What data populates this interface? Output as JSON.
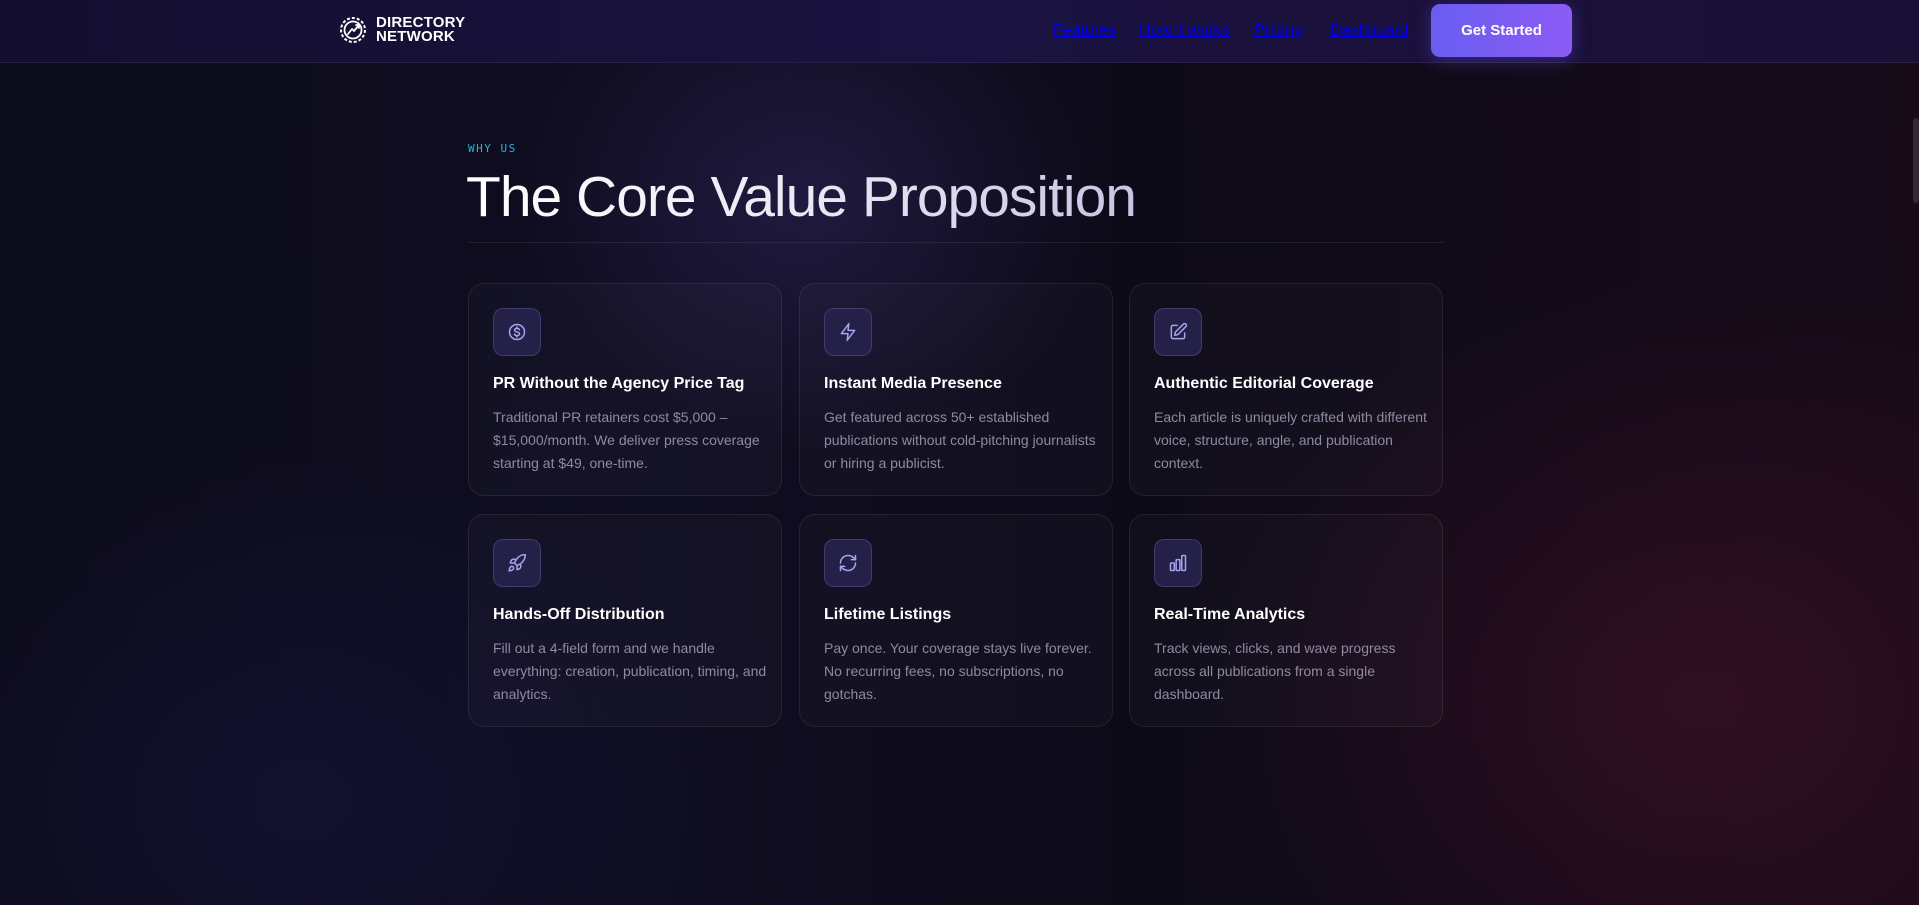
{
  "brand": {
    "line1": "DIRECTORY",
    "line2": "NETWORK",
    "logo_icon": "gear-chart-icon"
  },
  "nav": {
    "items": [
      {
        "label": "Features"
      },
      {
        "label": "How it works"
      },
      {
        "label": "Pricing"
      },
      {
        "label": "Dashboard"
      }
    ],
    "cta_label": "Get Started"
  },
  "section": {
    "eyebrow": "WHY US",
    "title": "The Core Value Proposition",
    "cards": [
      {
        "icon": "dollar-icon",
        "title": "PR Without the Agency Price Tag",
        "description": "Traditional PR retainers cost $5,000 – $15,000/month. We deliver press coverage starting at $49, one-time."
      },
      {
        "icon": "lightning-icon",
        "title": "Instant Media Presence",
        "description": "Get featured across 50+ established publications without cold-pitching journalists or hiring a publicist."
      },
      {
        "icon": "edit-icon",
        "title": "Authentic Editorial Coverage",
        "description": "Each article is uniquely crafted with different voice, structure, angle, and publication context."
      },
      {
        "icon": "rocket-icon",
        "title": "Hands-Off Distribution",
        "description": "Fill out a 4-field form and we handle everything: creation, publication, timing, and analytics."
      },
      {
        "icon": "refresh-icon",
        "title": "Lifetime Listings",
        "description": "Pay once. Your coverage stays live forever. No recurring fees, no subscriptions, no gotchas."
      },
      {
        "icon": "bar-chart-icon",
        "title": "Real-Time Analytics",
        "description": "Track views, clicks, and wave progress across all publications from a single dashboard."
      }
    ]
  },
  "colors": {
    "accent": "#7c5cf5",
    "eyebrow": "#22b8d8",
    "icon_stroke": "#a9a3ee",
    "card_text": "#8e8aa3"
  }
}
